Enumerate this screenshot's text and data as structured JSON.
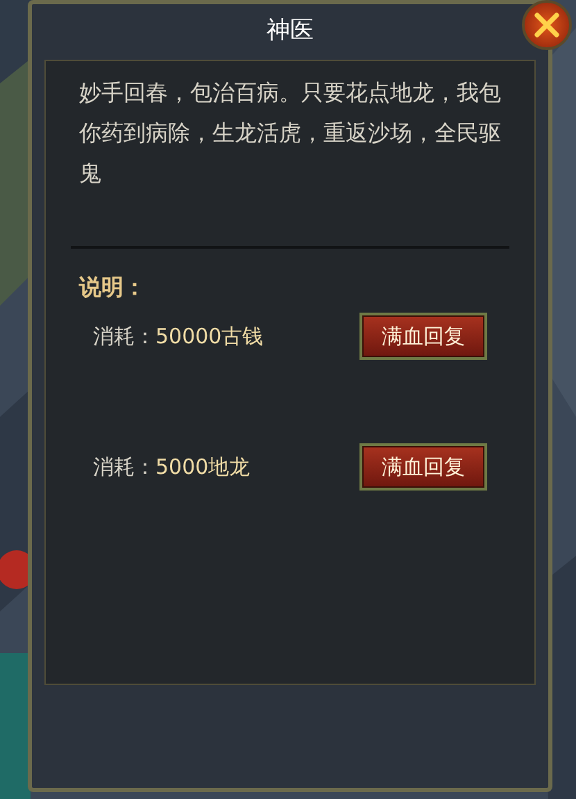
{
  "dialog": {
    "title": "神医",
    "description": "妙手回春，包治百病。只要花点地龙，我包你药到病除，生龙活虎，重返沙场，全民驱鬼",
    "section_title": "说明：",
    "options": [
      {
        "label": "消耗：",
        "cost": "50000古钱",
        "button": "满血回复"
      },
      {
        "label": "消耗：",
        "cost": "5000地龙",
        "button": "满血回复"
      }
    ]
  }
}
